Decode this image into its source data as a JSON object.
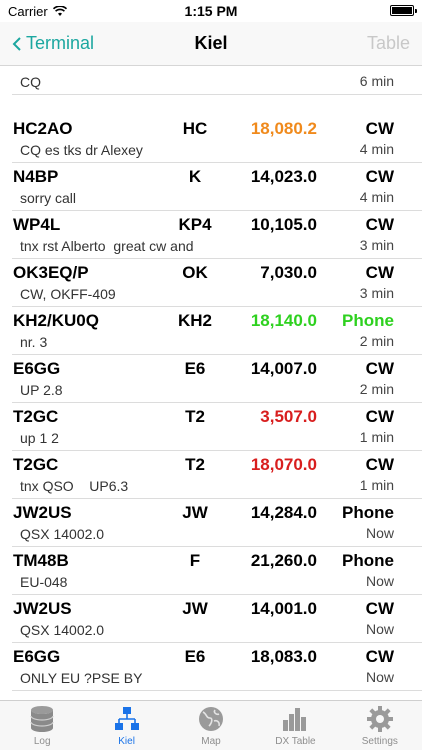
{
  "status_bar": {
    "carrier": "Carrier",
    "time": "1:15 PM"
  },
  "nav": {
    "back_label": "Terminal",
    "title": "Kiel",
    "right_label": "Table"
  },
  "spots": [
    {
      "call": "",
      "prefix": "",
      "freq": "",
      "freq_color": "#000000",
      "mode": "",
      "mode_color": "#000000",
      "comment": "CQ",
      "age": "6 min"
    },
    {
      "call": "HC2AO",
      "prefix": "HC",
      "freq": "18,080.2",
      "freq_color": "#f08a1c",
      "mode": "CW",
      "mode_color": "#000000",
      "comment": "CQ es tks dr Alexey",
      "age": "4 min"
    },
    {
      "call": "N4BP",
      "prefix": "K",
      "freq": "14,023.0",
      "freq_color": "#000000",
      "mode": "CW",
      "mode_color": "#000000",
      "comment": "sorry call",
      "age": "4 min"
    },
    {
      "call": "WP4L",
      "prefix": "KP4",
      "freq": "10,105.0",
      "freq_color": "#000000",
      "mode": "CW",
      "mode_color": "#000000",
      "comment": "tnx rst Alberto  great cw and",
      "age": "3 min"
    },
    {
      "call": "OK3EQ/P",
      "prefix": "OK",
      "freq": "7,030.0",
      "freq_color": "#000000",
      "mode": "CW",
      "mode_color": "#000000",
      "comment": "CW, OKFF-409",
      "age": "3 min"
    },
    {
      "call": "KH2/KU0Q",
      "prefix": "KH2",
      "freq": "18,140.0",
      "freq_color": "#2ed11f",
      "mode": "Phone",
      "mode_color": "#2ed11f",
      "comment": "nr. 3",
      "age": "2 min"
    },
    {
      "call": "E6GG",
      "prefix": "E6",
      "freq": "14,007.0",
      "freq_color": "#000000",
      "mode": "CW",
      "mode_color": "#000000",
      "comment": "UP 2.8",
      "age": "2 min"
    },
    {
      "call": "T2GC",
      "prefix": "T2",
      "freq": "3,507.0",
      "freq_color": "#d81e1e",
      "mode": "CW",
      "mode_color": "#000000",
      "comment": "up 1 2",
      "age": "1 min"
    },
    {
      "call": "T2GC",
      "prefix": "T2",
      "freq": "18,070.0",
      "freq_color": "#d81e1e",
      "mode": "CW",
      "mode_color": "#000000",
      "comment": "tnx QSO    UP6.3",
      "age": "1 min"
    },
    {
      "call": "JW2US",
      "prefix": "JW",
      "freq": "14,284.0",
      "freq_color": "#000000",
      "mode": "Phone",
      "mode_color": "#000000",
      "comment": "QSX 14002.0",
      "age": "Now"
    },
    {
      "call": "TM48B",
      "prefix": "F",
      "freq": "21,260.0",
      "freq_color": "#000000",
      "mode": "Phone",
      "mode_color": "#000000",
      "comment": "EU-048",
      "age": "Now"
    },
    {
      "call": "JW2US",
      "prefix": "JW",
      "freq": "14,001.0",
      "freq_color": "#000000",
      "mode": "CW",
      "mode_color": "#000000",
      "comment": "QSX 14002.0",
      "age": "Now"
    },
    {
      "call": "E6GG",
      "prefix": "E6",
      "freq": "18,083.0",
      "freq_color": "#000000",
      "mode": "CW",
      "mode_color": "#000000",
      "comment": "ONLY EU ?PSE BY",
      "age": "Now"
    }
  ],
  "tabs": [
    {
      "label": "Log",
      "icon": "database-icon",
      "active": false
    },
    {
      "label": "Kiel",
      "icon": "cluster-network-icon",
      "active": true
    },
    {
      "label": "Map",
      "icon": "globe-icon",
      "active": false
    },
    {
      "label": "DX Table",
      "icon": "bar-chart-icon",
      "active": false
    },
    {
      "label": "Settings",
      "icon": "gear-icon",
      "active": false
    }
  ]
}
